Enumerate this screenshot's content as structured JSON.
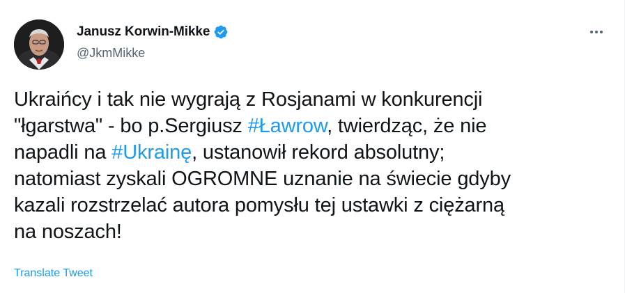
{
  "tweet": {
    "author": {
      "display_name": "Janusz Korwin-Mikke",
      "handle": "@JkmMikke",
      "verified": true,
      "avatar_icon": "avatar-photo"
    },
    "more_icon": "more-options-icon",
    "text_lines": [
      [
        {
          "text": "Ukraińcy i tak nie wygrają z Rosjanami w konkurencji",
          "type": "text"
        }
      ],
      [
        {
          "text": "\"łgarstwa\" - bo p.Sergiusz ",
          "type": "text"
        },
        {
          "text": "#Ławrow",
          "type": "hashtag"
        },
        {
          "text": ", twierdząc, że nie",
          "type": "text"
        }
      ],
      [
        {
          "text": "napadli na ",
          "type": "text"
        },
        {
          "text": "#Ukrainę",
          "type": "hashtag"
        },
        {
          "text": ", ustanowił rekord absolutny;",
          "type": "text"
        }
      ],
      [
        {
          "text": "natomiast zyskali OGROMNE uznanie na świecie gdyby",
          "type": "text"
        }
      ],
      [
        {
          "text": "kazali rozstrzelać autora pomysłu tej ustawki z ciężarną",
          "type": "text"
        }
      ],
      [
        {
          "text": "na noszach!",
          "type": "text"
        }
      ]
    ],
    "translate_label": "Translate Tweet"
  },
  "colors": {
    "link": "#1d9bf0",
    "text": "#0f1419",
    "secondary": "#536471",
    "verified": "#1d9bf0"
  }
}
